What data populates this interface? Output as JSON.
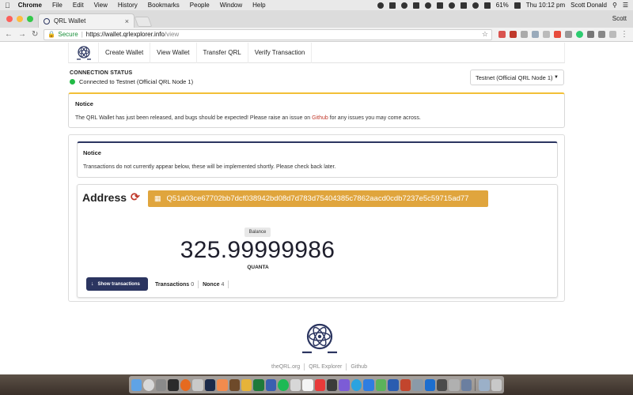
{
  "menubar": {
    "apple_icon": "apple-icon",
    "app_name": "Chrome",
    "items": [
      "File",
      "Edit",
      "View",
      "History",
      "Bookmarks",
      "People",
      "Window",
      "Help"
    ],
    "battery": "61%",
    "clock": "Thu 10:12 pm",
    "user": "Scott Donald"
  },
  "browser": {
    "tab_title": "QRL Wallet",
    "profile": "Scott",
    "secure_label": "Secure",
    "url_host": "https://wallet.qrlexplorer.info",
    "url_path": "/view"
  },
  "nav": {
    "items": [
      "Create Wallet",
      "View Wallet",
      "Transfer QRL",
      "Verify Transaction"
    ]
  },
  "connection": {
    "title": "CONNECTION STATUS",
    "status": "Connected to Testnet (Official QRL Node 1)",
    "network_selected": "Testnet (Official QRL Node 1)",
    "status_color": "#21ba45"
  },
  "notice1": {
    "title": "Notice",
    "text_before": "The QRL Wallet has just been released, and bugs should be expected! Please raise an issue on ",
    "link": "Github",
    "text_after": " for any issues you may come across."
  },
  "notice2": {
    "title": "Notice",
    "text": "Transactions do not currently appear below, these will be implemented shortly. Please check back later."
  },
  "wallet": {
    "address_label": "Address",
    "address": "Q51a03ce67702bb7dcf038942bd08d7d783d75404385c7862aacd0cdb7237e5c59715ad77",
    "balance_label": "Balance",
    "balance": "325.99999986",
    "unit": "QUANTA",
    "show_tx_label": "Show transactions",
    "transactions_label": "Transactions",
    "transactions_count": "0",
    "nonce_label": "Nonce",
    "nonce": "4"
  },
  "footer": {
    "links": [
      "theQRL.org",
      "QRL Explorer",
      "Github"
    ]
  },
  "colors": {
    "accent_navy": "#2b3560",
    "address_badge": "#e0a53d",
    "notice_warning": "#f2c037",
    "link_red": "#c0392b"
  }
}
